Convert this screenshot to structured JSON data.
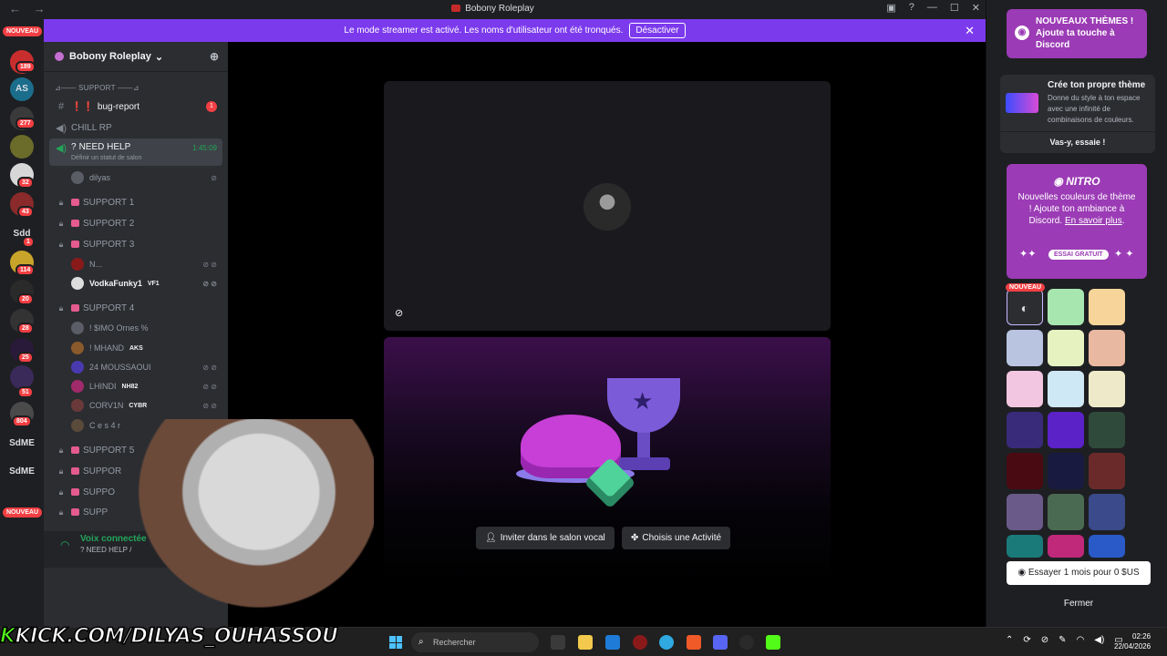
{
  "window": {
    "title": "Bobony Roleplay"
  },
  "banner": {
    "text": "Le mode streamer est activé. Les noms d'utilisateur ont été tronqués.",
    "button_label": "Désactiver"
  },
  "rail": {
    "new_top": "NOUVEAU",
    "new_bottom": "NOUVEAU",
    "labels": [
      "AS",
      "Sdd",
      "SdME",
      "SdME"
    ],
    "badges": [
      "189",
      "277",
      "32",
      "43",
      "1",
      "114",
      "20",
      "28",
      "25",
      "51",
      "804"
    ]
  },
  "guild": {
    "name": "Bobony Roleplay"
  },
  "channels": {
    "support_category": "SUPPORT",
    "bug_report": "bug-report",
    "bug_report_badge": "1",
    "chill_rp": "CHILL RP",
    "need_help": "NEED HELP",
    "need_help_sub": "Définir un statut de salon",
    "need_help_time": "1:45:09",
    "support1": "SUPPORT 1",
    "support2": "SUPPORT 2",
    "support3": "SUPPORT 3",
    "support4": "SUPPORT 4",
    "support5": "SUPPORT 5",
    "support6": "SUPPOR",
    "support7": "SUPPO",
    "support8": "SUPP"
  },
  "voice_users": {
    "need_help": [
      "dilyas"
    ],
    "support3": [
      {
        "name": "N...",
        "tag": ""
      },
      {
        "name": "VodkaFunky1",
        "tag": "VF1"
      }
    ],
    "support4": [
      {
        "name": "! $IMO Ornes %",
        "tag": ""
      },
      {
        "name": "! MHAND",
        "tag": "AKS"
      },
      {
        "name": "24 MOUSSAOUI",
        "tag": ""
      },
      {
        "name": "LHINDI",
        "tag": "NH82"
      },
      {
        "name": "CORV1N",
        "tag": "CYBR"
      },
      {
        "name": "C e s 4 r",
        "tag": ""
      }
    ]
  },
  "voice_connected": {
    "status": "Voix connectée",
    "channel": "NEED HELP /"
  },
  "stage": {
    "invite_label": "Inviter dans le salon vocal",
    "activity_label": "Choisis une Activité"
  },
  "right_panel": {
    "promo_title": "NOUVEAUX THÈMES ! Ajoute ta touche à Discord",
    "own_theme_title": "Crée ton propre thème",
    "own_theme_desc": "Donne du style à ton espace avec une infinité de combinaisons de couleurs.",
    "own_theme_try": "Vas-y, essaie !",
    "nitro_logo": "NITRO",
    "nitro_desc": "Nouvelles couleurs de thème ! Ajoute ton ambiance à Discord.",
    "nitro_link": "En savoir plus",
    "nitro_trial_pill": "ESSAI GRATUIT",
    "new_pill": "NOUVEAU",
    "trial_button": "Essayer 1 mois pour 0 $US",
    "close_button": "Fermer",
    "swatches": [
      "#2b2d31",
      "#a8e6b0",
      "#f7d59a",
      "#b8c4e0",
      "#e6f2c0",
      "#e8b8a0",
      "#f2c6e0",
      "#cfe8f5",
      "#eee9c8",
      "#3a2a7a",
      "#5b22c8",
      "#2f4a3a",
      "#4a0a12",
      "#181a40",
      "#6a2a2a",
      "#6a5a8a",
      "#4a6a52",
      "#3a4a8a",
      "#1a7a7a",
      "#c0287a",
      "#2a5ac8"
    ]
  },
  "caption": {
    "k": "K",
    "text": "KICK.COM/DILYAS_OUHASSOU"
  },
  "taskbar": {
    "search_placeholder": "Rechercher",
    "time": "02:26",
    "date": "22/04/2026"
  }
}
